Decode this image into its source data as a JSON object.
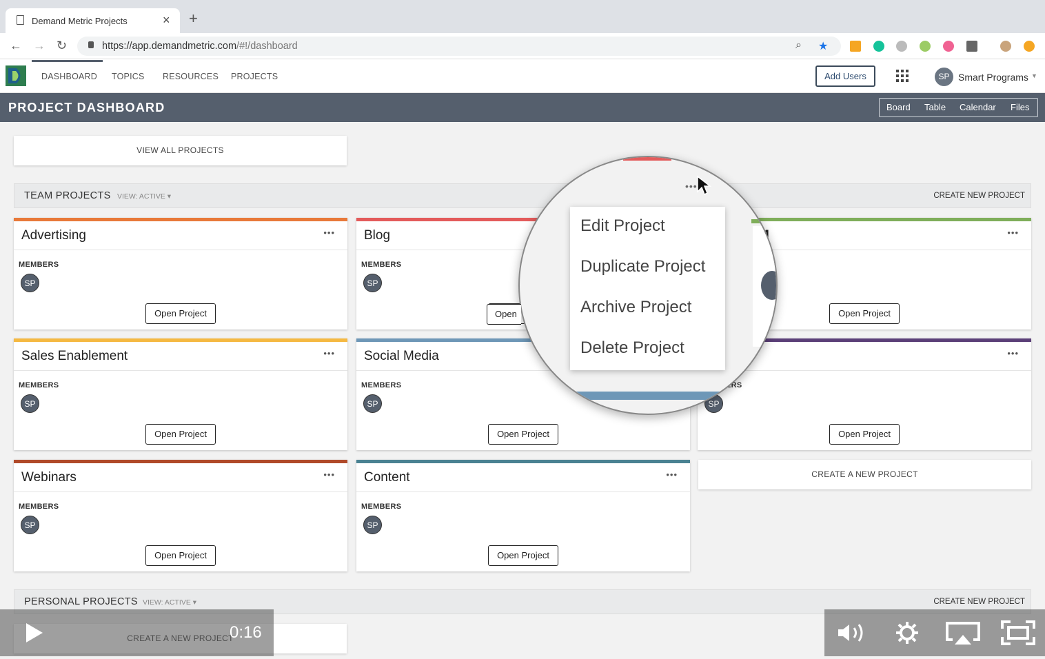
{
  "browser": {
    "tab_title": "Demand Metric Projects",
    "tab_close": "×",
    "new_tab": "+",
    "url_host": "https://app.demandmetric.com",
    "url_path": "/#!/dashboard"
  },
  "nav": {
    "items": [
      "DASHBOARD",
      "TOPICS",
      "RESOURCES",
      "PROJECTS"
    ],
    "add_users": "Add Users",
    "user_initials": "SP",
    "user_name": "Smart Programs"
  },
  "dashboard": {
    "title": "PROJECT DASHBOARD",
    "views": [
      "Board",
      "Table",
      "Calendar",
      "Files"
    ],
    "view_all": "VIEW ALL PROJECTS"
  },
  "team": {
    "title": "TEAM PROJECTS",
    "view": "VIEW: ACTIVE",
    "create": "CREATE NEW PROJECT",
    "create_card": "CREATE A NEW PROJECT"
  },
  "card_common": {
    "members_label": "MEMBERS",
    "open_label": "Open Project",
    "dots": "•••",
    "initials": "SP"
  },
  "cards": [
    {
      "title": "Advertising",
      "color": "#e8793a"
    },
    {
      "title": "Blog",
      "color": "#e35b5b"
    },
    {
      "title": "M",
      "color": "#7fae5a"
    },
    {
      "title": "Sales Enablement",
      "color": "#f5b942"
    },
    {
      "title": "Social Media",
      "color": "#6e97b7"
    },
    {
      "title": "",
      "color": "#5b3f78"
    },
    {
      "title": "Webinars",
      "color": "#b04a2a"
    },
    {
      "title": "Content",
      "color": "#4a8292"
    }
  ],
  "menu": {
    "items": [
      "Edit Project",
      "Duplicate Project",
      "Archive Project",
      "Delete Project"
    ],
    "peek_members": "ERS",
    "peek_initials": "SP",
    "peek_open": "Open"
  },
  "personal": {
    "title": "PERSONAL PROJECTS",
    "view": "VIEW: ACTIVE",
    "create": "CREATE NEW PROJECT",
    "create_card": "CREATE A NEW PROJECT"
  },
  "player": {
    "time": "0:16"
  }
}
